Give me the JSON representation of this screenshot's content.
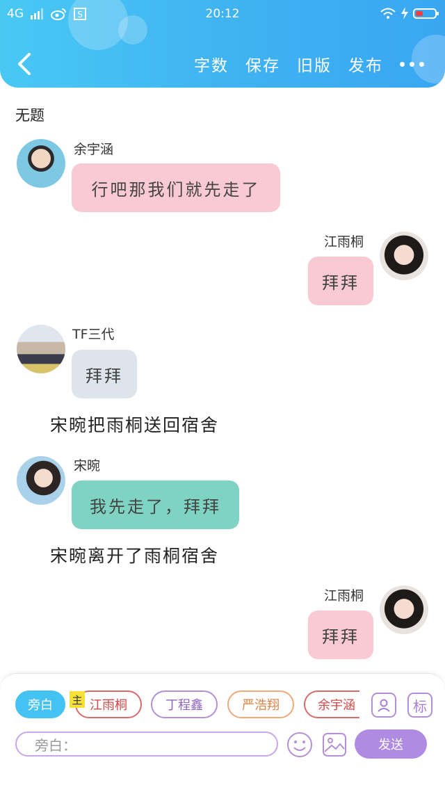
{
  "status_bar": {
    "network": "4G",
    "time": "20:12"
  },
  "header": {
    "nav": [
      "字数",
      "保存",
      "旧版",
      "发布"
    ]
  },
  "document": {
    "title": "无题"
  },
  "messages": [
    {
      "name": "余宇涵",
      "text": "行吧那我们就先走了"
    },
    {
      "name": "江雨桐",
      "text": "拜拜"
    },
    {
      "name": "TF三代",
      "text": "拜拜"
    },
    {
      "narration": "宋晼把雨桐送回宿舍"
    },
    {
      "name": "宋晼",
      "text": "我先走了，拜拜"
    },
    {
      "narration": "宋晼离开了雨桐宿舍"
    },
    {
      "name": "江雨桐",
      "text": "拜拜"
    }
  ],
  "toolbar": {
    "roles": [
      "旁白",
      "江雨桐",
      "丁程鑫",
      "严浩翔",
      "余宇涵"
    ],
    "main_tag": "主",
    "tag_button": "标",
    "input_label": "旁白：",
    "send_label": "发送"
  },
  "colors": {
    "header": "#3fb2f2",
    "pink_bubble": "#f9c9d4",
    "gray_bubble": "#dde4ec",
    "teal_bubble": "#7ed3c3",
    "accent": "#b08be3"
  }
}
